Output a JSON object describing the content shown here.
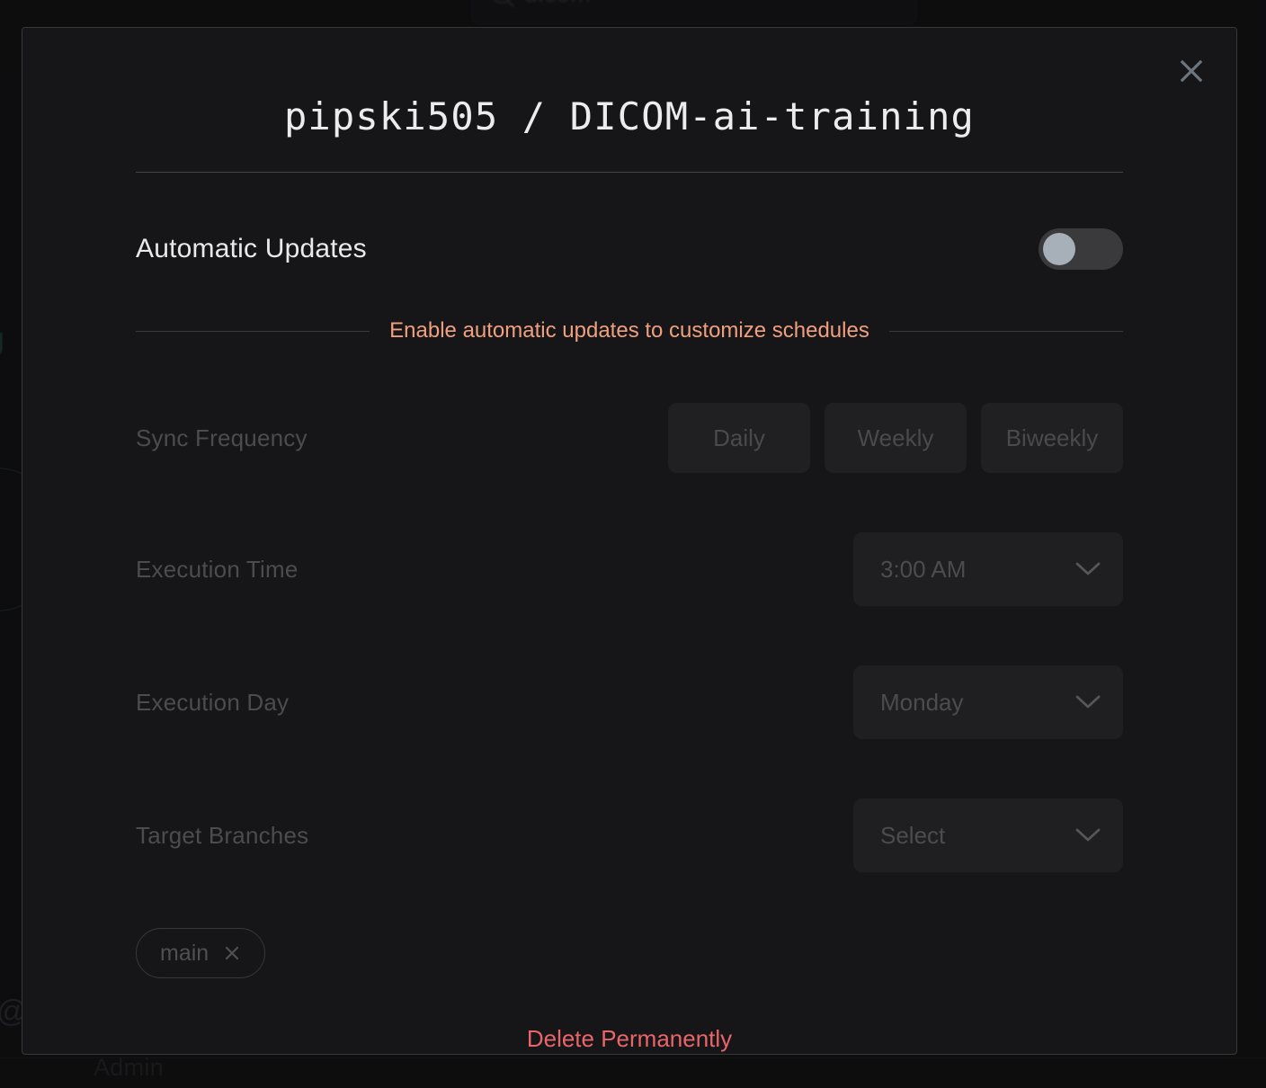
{
  "background": {
    "search_value": "dicom",
    "search_icon": "search-icon",
    "green_text": "ng",
    "at_glyph": "@",
    "admin_label": "Admin"
  },
  "modal": {
    "title": "pipski505 / DICOM-ai-training",
    "close_icon": "close-icon",
    "automatic_updates": {
      "label": "Automatic Updates",
      "toggle_state": "off"
    },
    "hint": "Enable automatic updates to customize schedules",
    "sync_frequency": {
      "label": "Sync Frequency",
      "options": [
        "Daily",
        "Weekly",
        "Biweekly"
      ],
      "selected": ""
    },
    "execution_time": {
      "label": "Execution Time",
      "value": "3:00 AM",
      "chevron_icon": "chevron-down-icon"
    },
    "execution_day": {
      "label": "Execution Day",
      "value": "Monday",
      "chevron_icon": "chevron-down-icon"
    },
    "target_branches": {
      "label": "Target Branches",
      "value": "Select",
      "chevron_icon": "chevron-down-icon",
      "chips": [
        {
          "label": "main",
          "remove_icon": "close-icon"
        }
      ]
    },
    "delete_label": "Delete Permanently"
  },
  "colors": {
    "accent_hint": "#f0a07e",
    "danger": "#e8656a",
    "modal_bg": "#161618",
    "toggle_knob": "#a7b0b8",
    "toggle_track": "#3a3a3d"
  }
}
